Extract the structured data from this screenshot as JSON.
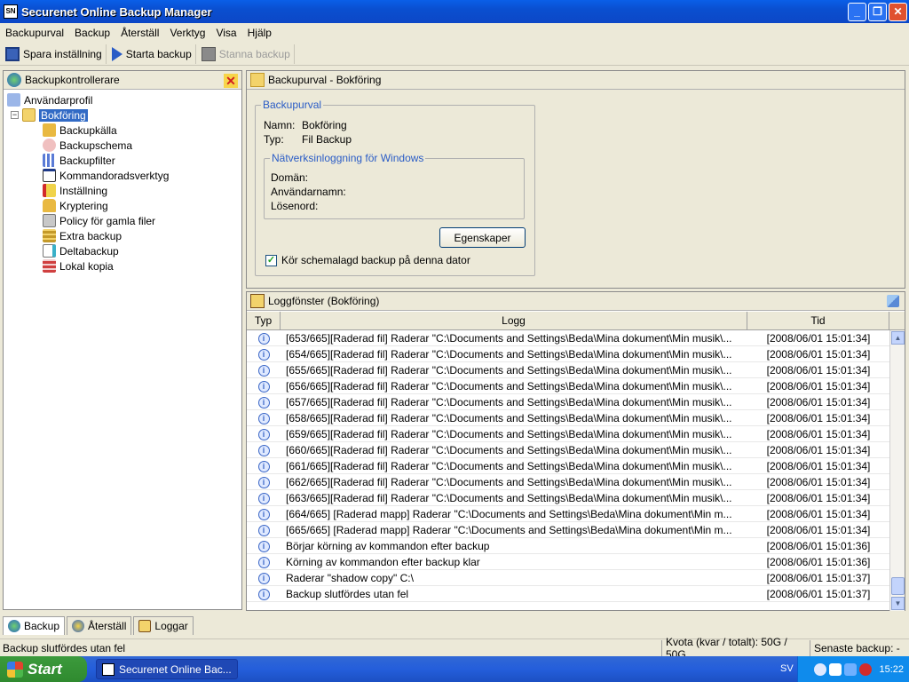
{
  "window": {
    "title": "Securenet Online Backup Manager"
  },
  "menu": [
    "Backupurval",
    "Backup",
    "Återställ",
    "Verktyg",
    "Visa",
    "Hjälp"
  ],
  "toolbar": {
    "save": "Spara inställning",
    "start": "Starta backup",
    "stop": "Stanna backup"
  },
  "left_panel": {
    "title": "Backupkontrollerare",
    "items": [
      {
        "label": "Användarprofil",
        "level": 0
      },
      {
        "label": "Bokföring",
        "level": 1
      },
      {
        "label": "Backupkälla",
        "level": 2
      },
      {
        "label": "Backupschema",
        "level": 2
      },
      {
        "label": "Backupfilter",
        "level": 2
      },
      {
        "label": "Kommandoradsverktyg",
        "level": 2
      },
      {
        "label": "Inställning",
        "level": 2
      },
      {
        "label": "Kryptering",
        "level": 2
      },
      {
        "label": "Policy för gamla filer",
        "level": 2
      },
      {
        "label": "Extra backup",
        "level": 2
      },
      {
        "label": "Deltabackup",
        "level": 2
      },
      {
        "label": "Lokal kopia",
        "level": 2
      }
    ]
  },
  "detail": {
    "header": "Backupurval - Bokföring",
    "group_title": "Backupurval",
    "name_label": "Namn:",
    "name_value": "Bokföring",
    "type_label": "Typ:",
    "type_value": "Fil Backup",
    "net_title": "Nätverksinloggning för Windows",
    "domain_label": "Domän:",
    "user_label": "Användarnamn:",
    "pass_label": "Lösenord:",
    "props_button": "Egenskaper",
    "sched_checkbox": "Kör schemalagd backup på denna dator"
  },
  "log": {
    "header": "Loggfönster (Bokföring)",
    "columns": [
      "Typ",
      "Logg",
      "Tid"
    ],
    "rows": [
      {
        "text": "[653/665][Raderad fil] Raderar \"C:\\Documents and Settings\\Beda\\Mina dokument\\Min musik\\...",
        "time": "[2008/06/01 15:01:34]"
      },
      {
        "text": "[654/665][Raderad fil] Raderar \"C:\\Documents and Settings\\Beda\\Mina dokument\\Min musik\\...",
        "time": "[2008/06/01 15:01:34]"
      },
      {
        "text": "[655/665][Raderad fil] Raderar \"C:\\Documents and Settings\\Beda\\Mina dokument\\Min musik\\...",
        "time": "[2008/06/01 15:01:34]"
      },
      {
        "text": "[656/665][Raderad fil] Raderar \"C:\\Documents and Settings\\Beda\\Mina dokument\\Min musik\\...",
        "time": "[2008/06/01 15:01:34]"
      },
      {
        "text": "[657/665][Raderad fil] Raderar \"C:\\Documents and Settings\\Beda\\Mina dokument\\Min musik\\...",
        "time": "[2008/06/01 15:01:34]"
      },
      {
        "text": "[658/665][Raderad fil] Raderar \"C:\\Documents and Settings\\Beda\\Mina dokument\\Min musik\\...",
        "time": "[2008/06/01 15:01:34]"
      },
      {
        "text": "[659/665][Raderad fil] Raderar \"C:\\Documents and Settings\\Beda\\Mina dokument\\Min musik\\...",
        "time": "[2008/06/01 15:01:34]"
      },
      {
        "text": "[660/665][Raderad fil] Raderar \"C:\\Documents and Settings\\Beda\\Mina dokument\\Min musik\\...",
        "time": "[2008/06/01 15:01:34]"
      },
      {
        "text": "[661/665][Raderad fil] Raderar \"C:\\Documents and Settings\\Beda\\Mina dokument\\Min musik\\...",
        "time": "[2008/06/01 15:01:34]"
      },
      {
        "text": "[662/665][Raderad fil] Raderar \"C:\\Documents and Settings\\Beda\\Mina dokument\\Min musik\\...",
        "time": "[2008/06/01 15:01:34]"
      },
      {
        "text": "[663/665][Raderad fil] Raderar \"C:\\Documents and Settings\\Beda\\Mina dokument\\Min musik\\...",
        "time": "[2008/06/01 15:01:34]"
      },
      {
        "text": "[664/665] [Raderad mapp] Raderar \"C:\\Documents and Settings\\Beda\\Mina dokument\\Min m...",
        "time": "[2008/06/01 15:01:34]"
      },
      {
        "text": "[665/665] [Raderad mapp] Raderar \"C:\\Documents and Settings\\Beda\\Mina dokument\\Min m...",
        "time": "[2008/06/01 15:01:34]"
      },
      {
        "text": "Börjar körning av kommandon efter backup",
        "time": "[2008/06/01 15:01:36]"
      },
      {
        "text": "Körning av kommandon efter backup klar",
        "time": "[2008/06/01 15:01:36]"
      },
      {
        "text": "Raderar \"shadow copy\" C:\\",
        "time": "[2008/06/01 15:01:37]"
      },
      {
        "text": "Backup slutfördes utan fel",
        "time": "[2008/06/01 15:01:37]"
      }
    ]
  },
  "tabs": [
    "Backup",
    "Återställ",
    "Loggar"
  ],
  "status": {
    "message": "Backup slutfördes utan fel",
    "quota": "Kvota (kvar / totalt): 50G / 50G",
    "last": "Senaste backup: -"
  },
  "taskbar": {
    "start": "Start",
    "task": "Securenet Online Bac...",
    "lang": "SV",
    "clock": "15:22"
  }
}
